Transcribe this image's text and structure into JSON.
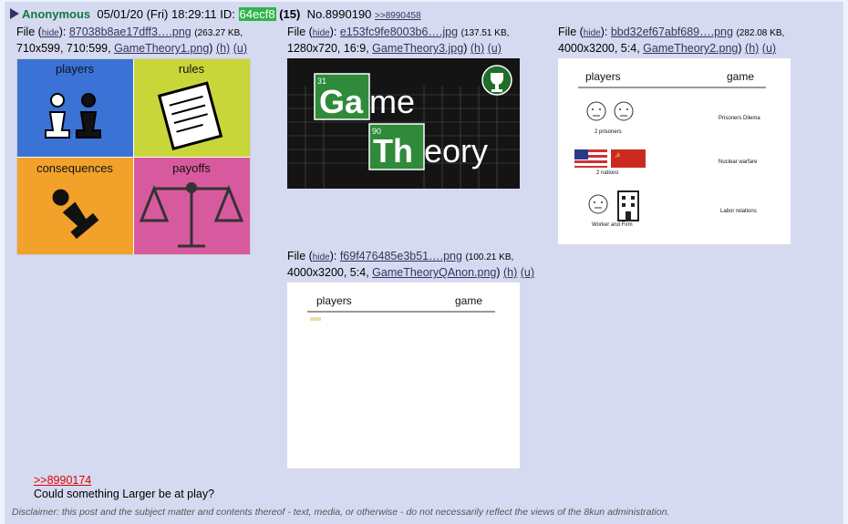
{
  "post": {
    "name": "Anonymous",
    "date": "05/01/20 (Fri) 18:29:11",
    "id_label": "ID:",
    "id": "64ecf8",
    "count": "(15)",
    "no": "No.8990190",
    "backlink": ">>8990458"
  },
  "files": [
    {
      "prefix": "File (",
      "hide": "hide",
      "sep": "):",
      "name": "87038b8ae17dff3….png",
      "meta": "(263.27 KB,",
      "meta2": "710x599, 710:599,",
      "orig": "GameTheory1.png",
      "h": "(h)",
      "u": "(u)",
      "labels": [
        "players",
        "rules",
        "consequences",
        "payoffs"
      ],
      "colors": [
        "#3a72d6",
        "#c9d63a",
        "#f2a12a",
        "#d85a9e"
      ]
    },
    {
      "prefix": "File (",
      "hide": "hide",
      "sep": "):",
      "name": "e153fc9fe8003b6….jpg",
      "meta": "(137.51 KB,",
      "meta2": "1280x720, 16:9,",
      "orig": "GameTheory3.jpg",
      "h": "(h)",
      "u": "(u)",
      "el1": "31",
      "el1_sym": "Ga",
      "el1_tail": "me",
      "el2": "90",
      "el2_sym": "Th",
      "el2_tail": "eory"
    },
    {
      "prefix": "File (",
      "hide": "hide",
      "sep": "):",
      "name": "bbd32ef67abf689….png",
      "meta": "(282.08 KB,",
      "meta2": "4000x3200, 5:4,",
      "orig": "GameTheory2.png",
      "h": "(h)",
      "u": "(u)",
      "col1": "players",
      "col2": "game",
      "rows": [
        {
          "who": "2 prisoners",
          "game": "Prisoners Dilema"
        },
        {
          "who": "2 nations",
          "game": "Nuclear warfare"
        },
        {
          "who": "Worker and Firm",
          "game": "Labor relations"
        }
      ]
    },
    {
      "prefix": "File (",
      "hide": "hide",
      "sep": "):",
      "name": "f69f476485e3b51….png",
      "meta": "(100.21 KB,",
      "meta2": "4000x3200, 5:4,",
      "orig": "GameTheoryQAnon.png",
      "h": "(h)",
      "u": "(u)",
      "col1": "players",
      "col2": "game"
    }
  ],
  "message": {
    "quote": ">>8990174",
    "text": "Could something Larger be at play?"
  },
  "disclaimer": "Disclaimer: this post and the subject matter and contents thereof - text, media, or otherwise - do not necessarily reflect the views of the 8kun administration."
}
